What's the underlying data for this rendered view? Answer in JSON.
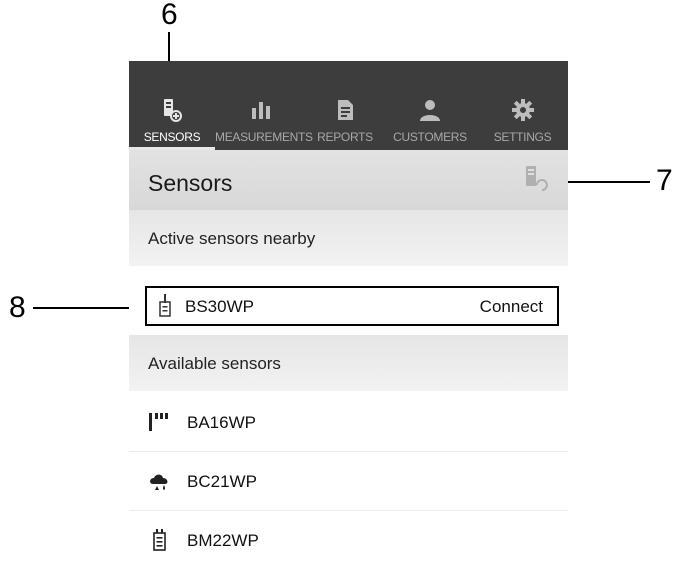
{
  "callouts": {
    "c6": "6",
    "c7": "7",
    "c8": "8"
  },
  "nav": {
    "tabs": [
      {
        "label": "SENSORS",
        "icon": "sensor-plus-icon",
        "active": true
      },
      {
        "label": "MEASUREMENTS",
        "icon": "bar-chart-icon",
        "active": false
      },
      {
        "label": "REPORTS",
        "icon": "report-icon",
        "active": false
      },
      {
        "label": "CUSTOMERS",
        "icon": "person-icon",
        "active": false
      },
      {
        "label": "SETTINGS",
        "icon": "gear-icon",
        "active": false
      }
    ]
  },
  "header": {
    "title": "Sensors",
    "refresh_icon": "sensor-refresh-icon"
  },
  "active_section": {
    "heading": "Active sensors nearby",
    "sensor": {
      "name": "BS30WP",
      "action": "Connect",
      "icon": "probe-icon"
    }
  },
  "available_section": {
    "heading": "Available sensors",
    "sensors": [
      {
        "name": "BA16WP",
        "icon": "signal-bars-icon"
      },
      {
        "name": "BC21WP",
        "icon": "cloud-drops-icon"
      },
      {
        "name": "BM22WP",
        "icon": "meter-icon"
      }
    ]
  },
  "colors": {
    "navbar": "#3d3d3d",
    "nav_label": "#a8a8a8",
    "nav_label_active": "#ffffff"
  }
}
